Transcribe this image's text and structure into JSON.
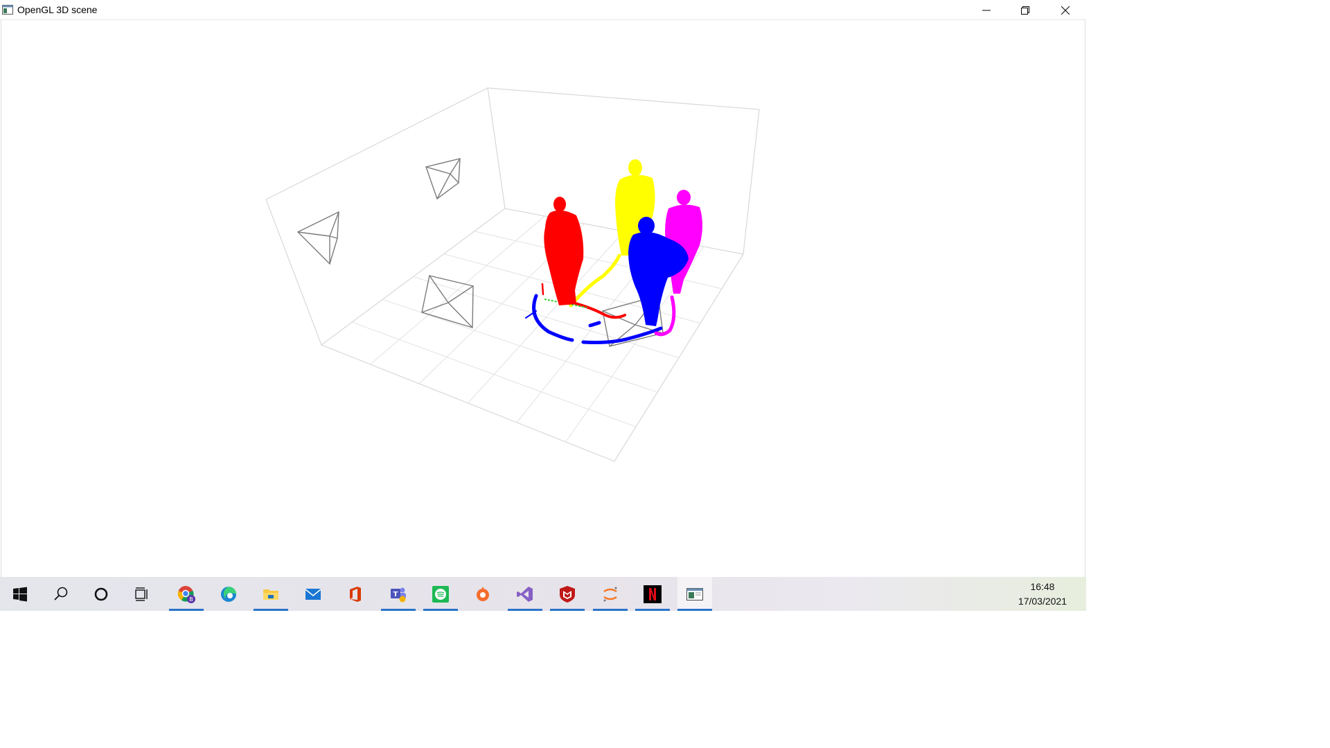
{
  "window": {
    "title": "OpenGL 3D scene",
    "icon": "opengl-window-icon",
    "controls": [
      "minimize-icon",
      "restore-icon",
      "close-icon"
    ]
  },
  "scene": {
    "person_colors": {
      "red": "#ff0000",
      "yellow": "#ffff00",
      "blue": "#0000ff",
      "magenta": "#ff00ff"
    },
    "bounding_box_color": "#d6d6d6",
    "camera_color": "#777777"
  },
  "taskbar": {
    "items": [
      {
        "name": "start-button",
        "icon": "windows-logo-icon",
        "running": false
      },
      {
        "name": "search-button",
        "icon": "search-icon",
        "running": false
      },
      {
        "name": "cortana-button",
        "icon": "cortana-circle-icon",
        "running": false
      },
      {
        "name": "task-view-button",
        "icon": "task-view-icon",
        "running": false
      },
      {
        "name": "chrome-taskbar-item",
        "icon": "chrome-icon",
        "running": true
      },
      {
        "name": "edge-taskbar-item",
        "icon": "edge-icon",
        "running": false
      },
      {
        "name": "file-explorer-taskbar-item",
        "icon": "folder-icon",
        "running": true
      },
      {
        "name": "mail-taskbar-item",
        "icon": "mail-icon",
        "running": false
      },
      {
        "name": "office-taskbar-item",
        "icon": "office-icon",
        "running": false
      },
      {
        "name": "teams-taskbar-item",
        "icon": "teams-icon",
        "running": true
      },
      {
        "name": "spotify-taskbar-item",
        "icon": "spotify-icon",
        "running": true
      },
      {
        "name": "origin-taskbar-item",
        "icon": "origin-icon",
        "running": false
      },
      {
        "name": "visual-studio-taskbar-item",
        "icon": "visual-studio-icon",
        "running": true
      },
      {
        "name": "mcafee-taskbar-item",
        "icon": "mcafee-icon",
        "running": true
      },
      {
        "name": "jupyter-taskbar-item",
        "icon": "jupyter-icon",
        "running": true
      },
      {
        "name": "netflix-taskbar-item",
        "icon": "netflix-icon",
        "running": true
      },
      {
        "name": "opengl-app-taskbar-item",
        "icon": "opengl-window-icon",
        "running": true
      }
    ],
    "clock": {
      "time": "16:48",
      "date": "17/03/2021"
    }
  }
}
